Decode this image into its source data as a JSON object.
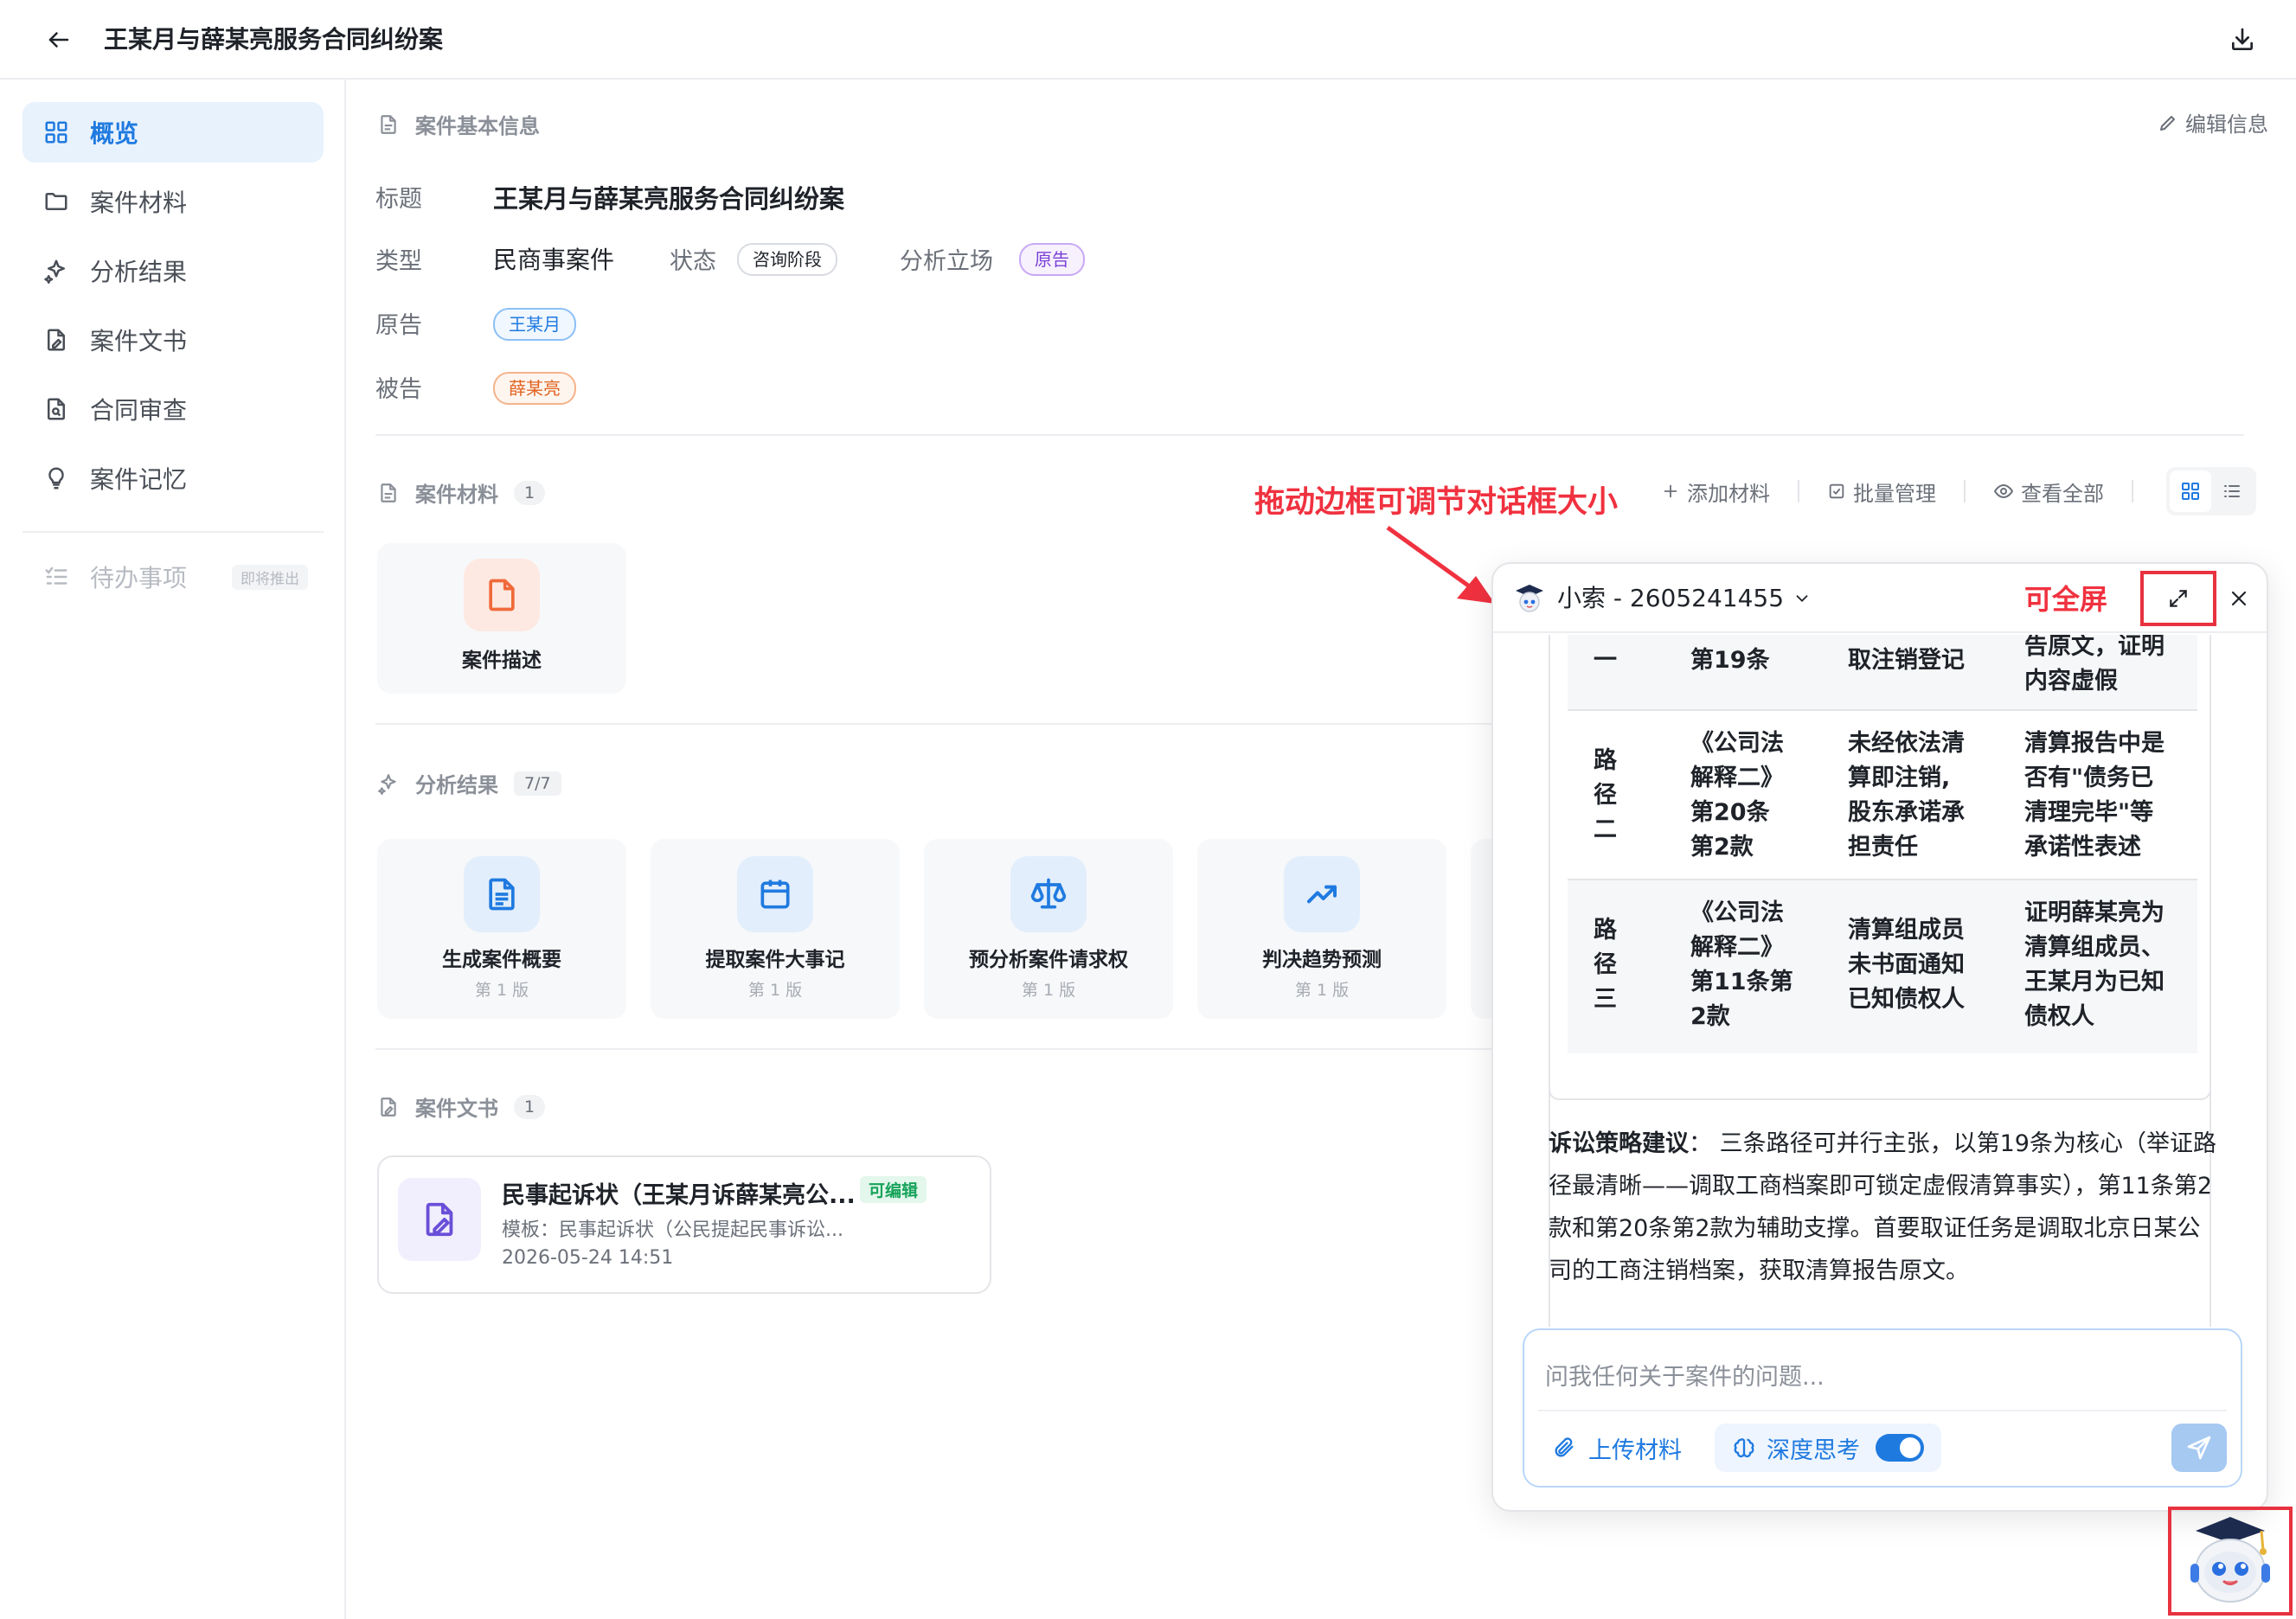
{
  "header": {
    "title": "王某月与薛某亮服务合同纠纷案"
  },
  "sidebar": {
    "items": [
      {
        "label": "概览",
        "icon": "grid-icon",
        "active": true
      },
      {
        "label": "案件材料",
        "icon": "folder-icon"
      },
      {
        "label": "分析结果",
        "icon": "sparkle-icon"
      },
      {
        "label": "案件文书",
        "icon": "document-pen-icon"
      },
      {
        "label": "合同审查",
        "icon": "document-search-icon"
      },
      {
        "label": "案件记忆",
        "icon": "lightbulb-icon"
      }
    ],
    "todo": {
      "label": "待办事项",
      "badge": "即将推出",
      "icon": "checklist-icon"
    }
  },
  "basic_info": {
    "section_title": "案件基本信息",
    "edit_label": "编辑信息",
    "title_label": "标题",
    "title_value": "王某月与薛某亮服务合同纠纷案",
    "type_label": "类型",
    "type_value": "民商事案件",
    "status_label": "状态",
    "status_value": "咨询阶段",
    "stance_label": "分析立场",
    "stance_value": "原告",
    "plaintiff_label": "原告",
    "plaintiff_value": "王某月",
    "defendant_label": "被告",
    "defendant_value": "薛某亮"
  },
  "materials": {
    "section_title": "案件材料",
    "count": "1",
    "toolbar": {
      "add": "添加材料",
      "batch": "批量管理",
      "view_all": "查看全部"
    },
    "items": [
      {
        "label": "案件描述",
        "icon": "file-icon"
      }
    ]
  },
  "annotations": {
    "resize_hint": "拖动边框可调节对话框大小",
    "fullscreen_hint": "可全屏"
  },
  "analysis": {
    "section_title": "分析结果",
    "count": "7/7",
    "cards": [
      {
        "label": "生成案件概要",
        "version": "第 1 版",
        "icon": "document-lines-icon"
      },
      {
        "label": "提取案件大事记",
        "version": "第 1 版",
        "icon": "calendar-icon"
      },
      {
        "label": "预分析案件请求权",
        "version": "第 1 版",
        "icon": "scales-icon"
      },
      {
        "label": "判决趋势预测",
        "version": "第 1 版",
        "icon": "trend-up-icon"
      }
    ]
  },
  "documents": {
    "section_title": "案件文书",
    "count": "1",
    "items": [
      {
        "title": "民事起诉状（王某月诉薛某亮公...",
        "badge": "可编辑",
        "template": "模板：民事起诉状（公民提起民事诉讼...",
        "date": "2026-05-24 14:51"
      }
    ]
  },
  "chat": {
    "name": "小索 - 2605241455",
    "table": {
      "rows": [
        {
          "path": "一",
          "law": "第19条",
          "fact": "取注销登记",
          "evidence": "告原文，证明\n内容虚假"
        },
        {
          "path": "路\n径\n二",
          "law": "《公司法\n解释二》\n第20条\n第2款",
          "fact": "未经依法清\n算即注销,\n股东承诺承\n担责任",
          "evidence": "清算报告中是\n否有\"债务已\n清理完毕\"等\n承诺性表述"
        },
        {
          "path": "路\n径\n三",
          "law": "《公司法\n解释二》\n第11条第\n2款",
          "fact": "清算组成员\n未书面通知\n已知债权人",
          "evidence": "证明薛某亮为\n清算组成员、\n王某月为已知\n债权人"
        }
      ]
    },
    "strategy_label": "诉讼策略建议",
    "strategy_text": "：  三条路径可并行主张，以第19条为核心（举证路径最清晰——调取工商档案即可锁定虚假清算事实），第11条第2款和第20条第2款为辅助支撑。首要取证任务是调取北京日某公司的工商注销档案，获取清算报告原文。",
    "input_placeholder": "问我任何关于案件的问题...",
    "upload_label": "上传材料",
    "deep_think_label": "深度思考",
    "deep_think_on": true
  },
  "colors": {
    "accent": "#1f7ae0",
    "annotation_red": "#f0313f"
  }
}
